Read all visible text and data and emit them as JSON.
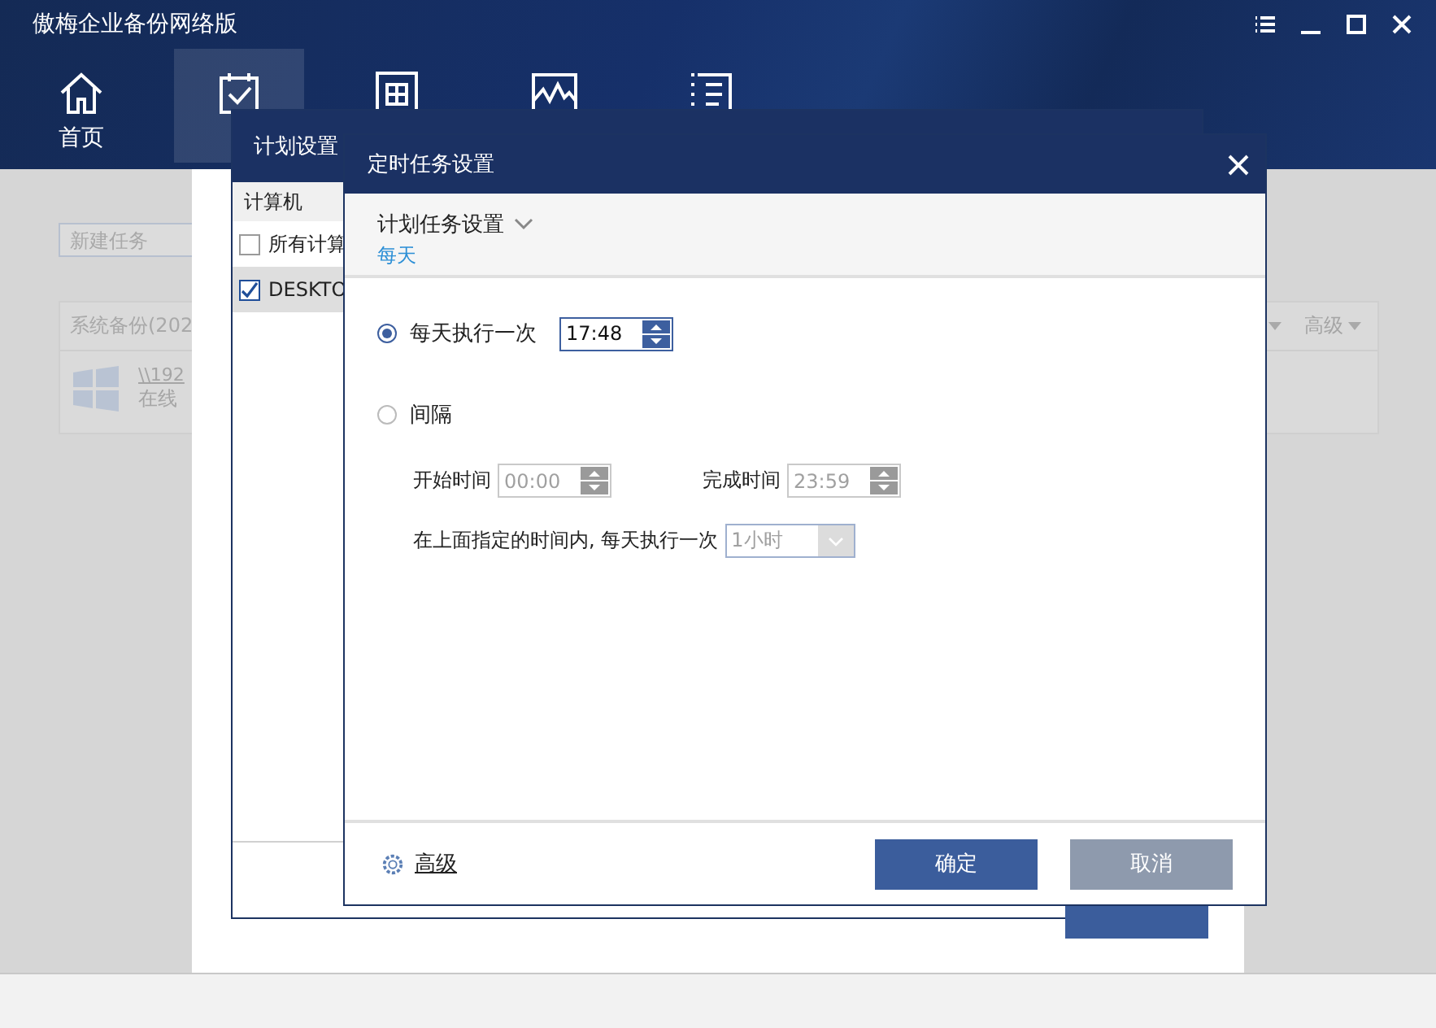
{
  "window": {
    "title": "傲梅企业备份网络版"
  },
  "nav": [
    {
      "kind": "home",
      "label": "首页",
      "selected": false
    },
    {
      "kind": "calendar",
      "selected": true
    },
    {
      "kind": "windows",
      "selected": false
    },
    {
      "kind": "monitor",
      "selected": false
    },
    {
      "kind": "list",
      "selected": false
    }
  ],
  "background": {
    "task_field": {
      "placeholder": "新建任务"
    },
    "task_card": {
      "title": "系统备份(202",
      "menu": "高级",
      "path": "\\\\192",
      "status": "在线"
    }
  },
  "plan_dialog": {
    "title": "计划设置",
    "column": "计算机",
    "computers": [
      {
        "name": "所有计算",
        "checked": false,
        "selected": false
      },
      {
        "name": "DESKTO",
        "checked": true,
        "selected": true
      }
    ]
  },
  "schedule_dialog": {
    "title": "定时任务设置",
    "section": "计划任务设置",
    "frequency": "每天",
    "options": [
      {
        "kind": "once",
        "label": "每天执行一次",
        "selected": true,
        "time": "17:48"
      },
      {
        "kind": "interval",
        "label": "间隔",
        "selected": false
      }
    ],
    "interval": {
      "disabled": true,
      "start_label": "开始时间",
      "start": "00:00",
      "end_label": "完成时间",
      "end": "23:59",
      "repeat_label": "在上面指定的时间内, 每天执行一次",
      "repeat": "1小时"
    },
    "advanced": "高级",
    "buttons": [
      {
        "kind": "primary",
        "label": "确定"
      },
      {
        "kind": "secondary",
        "label": "取消"
      }
    ]
  }
}
